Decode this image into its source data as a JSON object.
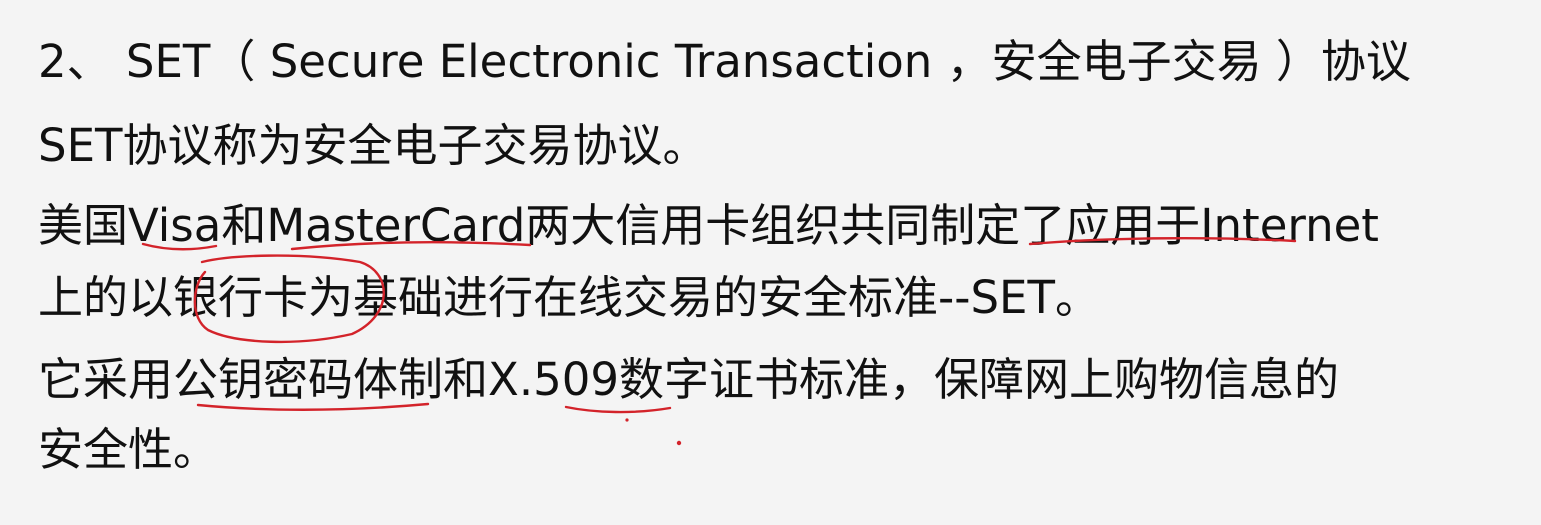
{
  "document": {
    "lines": [
      "2、 SET（ Secure Electronic Transaction ，安全电子交易 ）协议",
      "SET协议称为安全电子交易协议。",
      "美国Visa和MasterCard两大信用卡组织共同制定了应用于Internet",
      "上的以银行卡为基础进行在线交易的安全标准--SET。",
      "它采用公钥密码体制和X.509数字证书标准，保障网上购物信息的",
      "安全性。"
    ]
  },
  "colors": {
    "background": "#f4f4f4",
    "text": "#111111",
    "annotation_pen": "#d3232a"
  }
}
